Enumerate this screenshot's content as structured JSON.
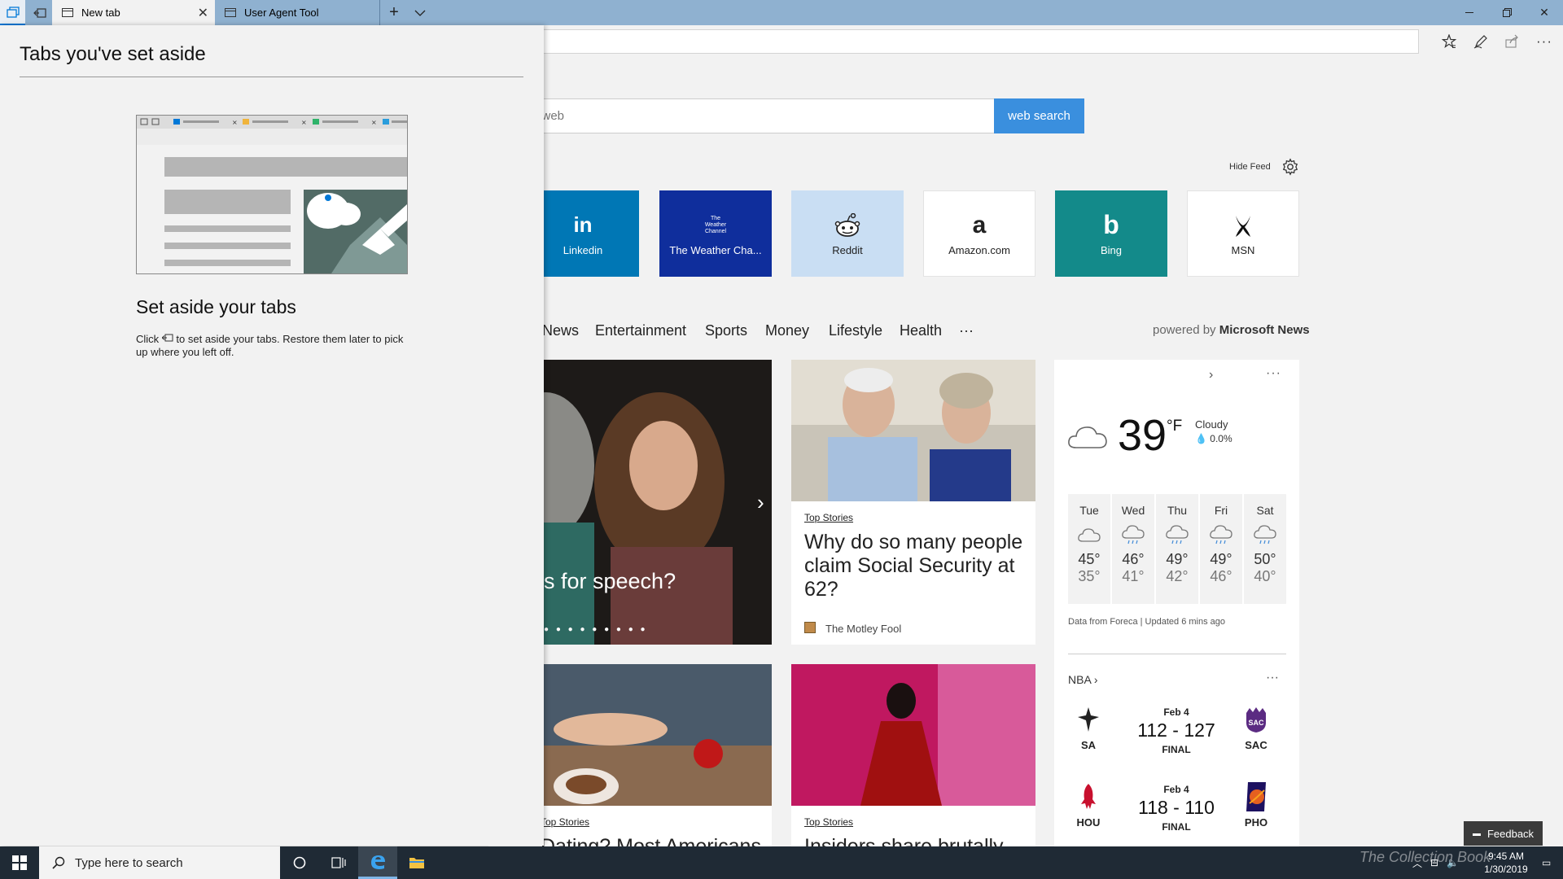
{
  "tabs": [
    {
      "label": "New tab"
    },
    {
      "label": "User Agent Tool"
    }
  ],
  "colors": {
    "accent": "#0078d7",
    "search_button": "#3a8fde",
    "titlebar": "#8fb1d0",
    "taskbar": "#1f2a35"
  },
  "search": {
    "placeholder": "e web",
    "button_label": "web search"
  },
  "feed": {
    "hide_label": "Hide Feed"
  },
  "top_sites": [
    {
      "label": "Linkedin",
      "glyph": "in",
      "bg": "#0077b5",
      "fg": "#ffffff"
    },
    {
      "label": "The Weather Cha...",
      "glyph": "The Weather Channel",
      "bg": "#0f2e9c",
      "fg": "#ffffff"
    },
    {
      "label": "Reddit",
      "glyph": "reddit-icon",
      "bg": "#c9def3",
      "fg": "#222222"
    },
    {
      "label": "Amazon.com",
      "glyph": "a",
      "bg": "#ffffff",
      "fg": "#222222"
    },
    {
      "label": "Bing",
      "glyph": "b",
      "bg": "#138a8a",
      "fg": "#ffffff"
    },
    {
      "label": "MSN",
      "glyph": "msn-icon",
      "bg": "#ffffff",
      "fg": "#222222"
    }
  ],
  "news_nav": {
    "categories": [
      "News",
      "Entertainment",
      "Sports",
      "Money",
      "Lifestyle",
      "Health",
      "···"
    ],
    "powered_prefix": "powered by",
    "powered_brand": "Microsoft News"
  },
  "cards": [
    {
      "tag": "",
      "headline": "s for speech?",
      "source": ""
    },
    {
      "tag": "Top Stories",
      "headline": "Why do so many people claim Social Security at 62?",
      "source": "The Motley Fool"
    },
    {
      "tag": "Top Stories",
      "headline": "Dating? Most Americans",
      "source": ""
    },
    {
      "tag": "Top Stories",
      "headline": "Insiders share brutally",
      "source": ""
    }
  ],
  "weather": {
    "temp": "39",
    "unit": "°F",
    "condition": "Cloudy",
    "precip": "0.0%",
    "forecast": [
      {
        "day": "Tue",
        "hi": "45°",
        "lo": "35°",
        "icon": "cloud-icon"
      },
      {
        "day": "Wed",
        "hi": "46°",
        "lo": "41°",
        "icon": "rain-icon"
      },
      {
        "day": "Thu",
        "hi": "49°",
        "lo": "42°",
        "icon": "rain-icon"
      },
      {
        "day": "Fri",
        "hi": "49°",
        "lo": "46°",
        "icon": "rain-icon"
      },
      {
        "day": "Sat",
        "hi": "50°",
        "lo": "40°",
        "icon": "rain-icon"
      }
    ],
    "footer": "Data from Foreca | Updated 6 mins ago"
  },
  "nba": {
    "title": "NBA",
    "games": [
      {
        "date": "Feb 4",
        "score": "112 - 127",
        "status": "FINAL",
        "away": "SA",
        "home": "SAC"
      },
      {
        "date": "Feb 4",
        "score": "118 - 110",
        "status": "FINAL",
        "away": "HOU",
        "home": "PHO"
      }
    ]
  },
  "aside": {
    "title": "Tabs you've set aside",
    "heading": "Set aside your tabs",
    "desc_before": "Click",
    "desc_after": "to set aside your tabs. Restore them later to pick up where you left off."
  },
  "taskbar": {
    "search_placeholder": "Type here to search",
    "time": "9:45 AM",
    "date": "1/30/2019",
    "feedback": "Feedback",
    "watermark": "The Collection Book"
  }
}
